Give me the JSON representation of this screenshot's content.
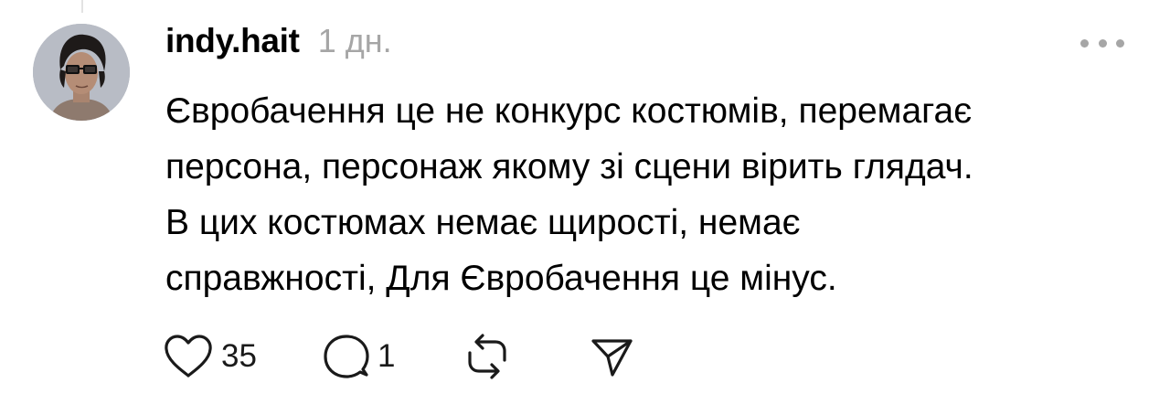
{
  "post": {
    "username": "indy.hait",
    "timestamp": "1 дн.",
    "text_lines": [
      "Євробачення це не конкурс костюмів, перемагає",
      "персона, персонаж якому зі сцени вірить глядач.",
      "В цих костюмах немає щирості, немає",
      "справжності, Для Євробачення це мінус."
    ],
    "more_icon": "more-horizontal-icon",
    "avatar_icon": "user-avatar"
  },
  "actions": {
    "like": {
      "icon": "heart-icon",
      "count": "35"
    },
    "reply": {
      "icon": "comment-icon",
      "count": "1"
    },
    "repost": {
      "icon": "repost-icon"
    },
    "share": {
      "icon": "send-icon"
    }
  },
  "colors": {
    "text": "#000000",
    "muted": "#a6a6a6",
    "background": "#ffffff"
  }
}
